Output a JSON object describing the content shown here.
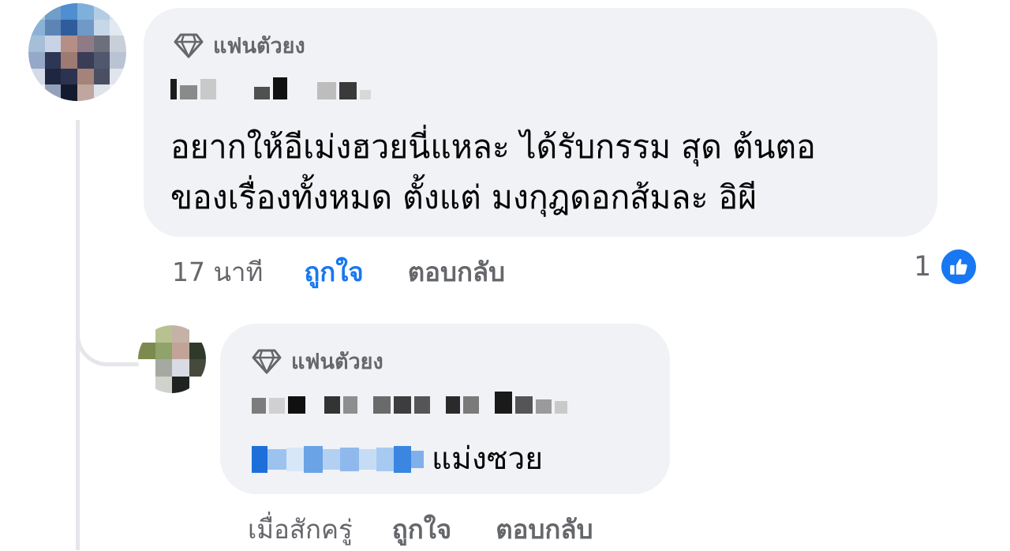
{
  "comment": {
    "badge": "แฟนตัวยง",
    "text_line1": "อยากให้อีเม่งฮวยนี่แหละ ได้รับกรรม สุด ต้นตอ",
    "text_line2": "ของเรื่องทั้งหมด ตั้งแต่ มงกุฎดอกส้มละ อิผี",
    "time": "17 นาที",
    "like_label": "ถูกใจ",
    "reply_label": "ตอบกลับ",
    "reaction_count": "1",
    "reaction_icon": "thumbs-up-icon"
  },
  "reply": {
    "badge": "แฟนตัวยง",
    "text": "แม่งซวย",
    "time": "เมื่อสักครู่",
    "like_label": "ถูกใจ",
    "reply_label": "ตอบกลับ"
  },
  "colors": {
    "bubble": "#f0f2f5",
    "secondary_text": "#65676b",
    "accent": "#1877f2",
    "thread_line": "#e4e6eb"
  }
}
